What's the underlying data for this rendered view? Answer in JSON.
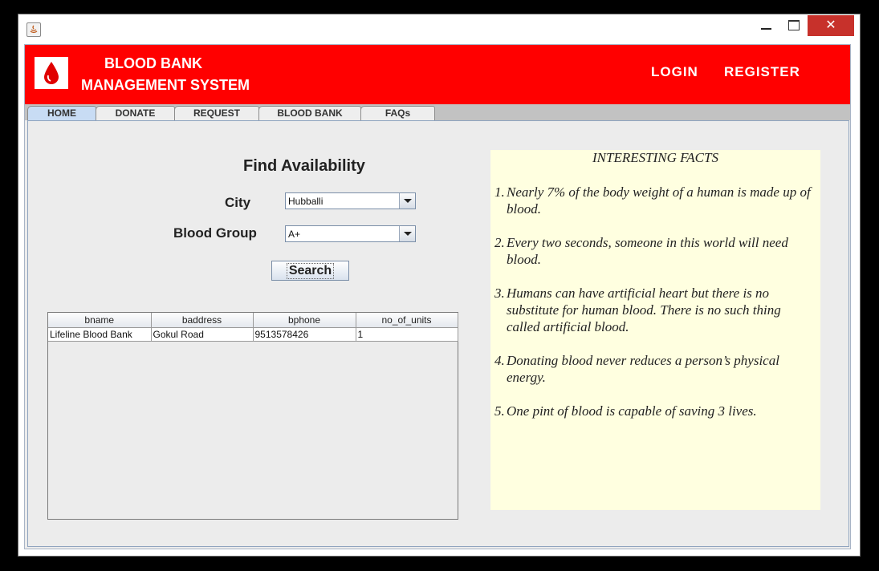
{
  "window": {
    "controls": {
      "close_symbol": "✕"
    }
  },
  "header": {
    "title_line1": "BLOOD BANK",
    "title_line2": "MANAGEMENT SYSTEM",
    "logo_icon": "blood-drop-icon",
    "nav": {
      "login": "LOGIN",
      "register": "REGISTER"
    },
    "background_color": "#ff0000"
  },
  "tabs": [
    {
      "label": "HOME",
      "active": true
    },
    {
      "label": "DONATE",
      "active": false
    },
    {
      "label": "REQUEST",
      "active": false
    },
    {
      "label": "BLOOD BANK",
      "active": false
    },
    {
      "label": "FAQs",
      "active": false
    }
  ],
  "search": {
    "title": "Find Availability",
    "city_label": "City",
    "city_value": "Hubballi",
    "blood_group_label": "Blood Group",
    "blood_group_value": "A+",
    "button_label": "Search"
  },
  "results_table": {
    "columns": [
      "bname",
      "baddress",
      "bphone",
      "no_of_units"
    ],
    "rows": [
      [
        "Lifeline Blood Bank",
        "Gokul Road",
        "9513578426",
        "1"
      ]
    ]
  },
  "facts": {
    "title": "INTERESTING FACTS",
    "background_color": "#ffffe0",
    "items": [
      {
        "num": "1.",
        "text": "Nearly 7% of the body weight of a human is made up of blood."
      },
      {
        "num": "2.",
        "text": "Every two seconds, someone in this world will need blood."
      },
      {
        "num": "3.",
        "text": "Humans can have artificial heart but there is no substitute for human blood. There is no such thing called artificial blood."
      },
      {
        "num": "4.",
        "text": "Donating blood never reduces a person’s physical energy."
      },
      {
        "num": "5.",
        "text": "One pint of blood is capable of saving 3 lives."
      }
    ]
  }
}
